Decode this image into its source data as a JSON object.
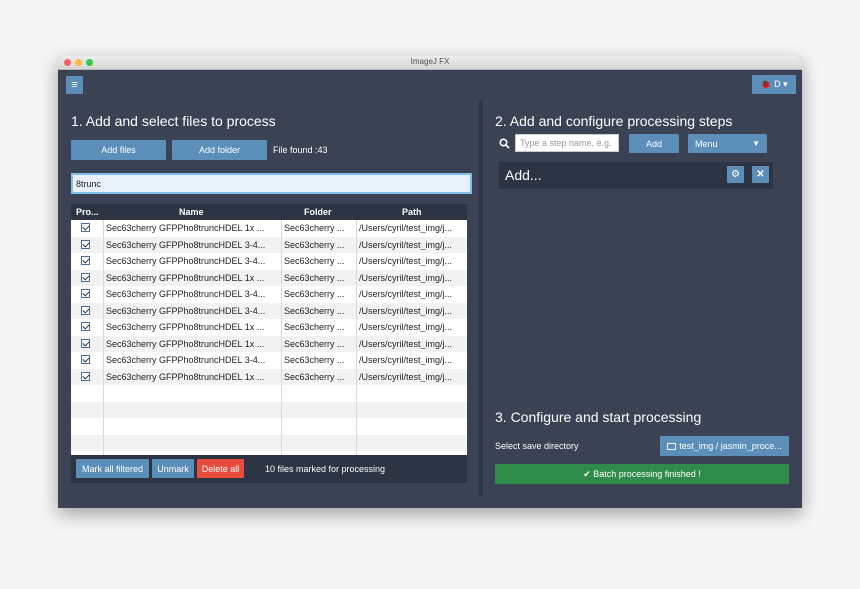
{
  "window": {
    "title": "ImageJ FX"
  },
  "toolbar": {
    "menu_icon": "≡",
    "user_label": "🐞 D ▾"
  },
  "left": {
    "heading": "1. Add and select files to process",
    "add_files": "Add files",
    "add_folder": "Add folder",
    "file_found": "File found :43",
    "filter_value": "8trunc",
    "columns": [
      "Pro...",
      "Name",
      "Folder",
      "Path"
    ],
    "rows": [
      {
        "name": "Sec63cherry GFPPho8truncHDEL 1x ...",
        "folder": "Sec63cherry ...",
        "path": "/Users/cyril/test_img/j..."
      },
      {
        "name": "Sec63cherry GFPPho8truncHDEL 3-4...",
        "folder": "Sec63cherry ...",
        "path": "/Users/cyril/test_img/j..."
      },
      {
        "name": "Sec63cherry GFPPho8truncHDEL 3-4...",
        "folder": "Sec63cherry ...",
        "path": "/Users/cyril/test_img/j..."
      },
      {
        "name": "Sec63cherry GFPPho8truncHDEL 1x ...",
        "folder": "Sec63cherry ...",
        "path": "/Users/cyril/test_img/j..."
      },
      {
        "name": "Sec63cherry GFPPho8truncHDEL 3-4...",
        "folder": "Sec63cherry ...",
        "path": "/Users/cyril/test_img/j..."
      },
      {
        "name": "Sec63cherry GFPPho8truncHDEL 3-4...",
        "folder": "Sec63cherry ...",
        "path": "/Users/cyril/test_img/j..."
      },
      {
        "name": "Sec63cherry GFPPho8truncHDEL 1x ...",
        "folder": "Sec63cherry ...",
        "path": "/Users/cyril/test_img/j..."
      },
      {
        "name": "Sec63cherry GFPPho8truncHDEL 1x ...",
        "folder": "Sec63cherry ...",
        "path": "/Users/cyril/test_img/j..."
      },
      {
        "name": "Sec63cherry GFPPho8truncHDEL 3-4...",
        "folder": "Sec63cherry ...",
        "path": "/Users/cyril/test_img/j..."
      },
      {
        "name": "Sec63cherry GFPPho8truncHDEL 1x ...",
        "folder": "Sec63cherry ...",
        "path": "/Users/cyril/test_img/j..."
      }
    ],
    "mark_all": "Mark all filtered",
    "unmark": "Unmark",
    "delete_all": "Delete all",
    "marked_status": "10 files marked for processing"
  },
  "right": {
    "heading2": "2. Add and configure processing steps",
    "search_placeholder": "Type a step name, e.g.",
    "add_btn": "Add",
    "menu_btn": "Menu",
    "add_step": "Add...",
    "heading3": "3. Configure and start processing",
    "save_dir_label": "Select save directory",
    "save_dir_value": "test_img / jasmin_proce...",
    "status": "✔ Batch processing finished !"
  },
  "colors": {
    "background": "#3a4253",
    "accent": "#5b8fb9",
    "danger": "#e84c3d",
    "success": "#2e8b4a"
  }
}
